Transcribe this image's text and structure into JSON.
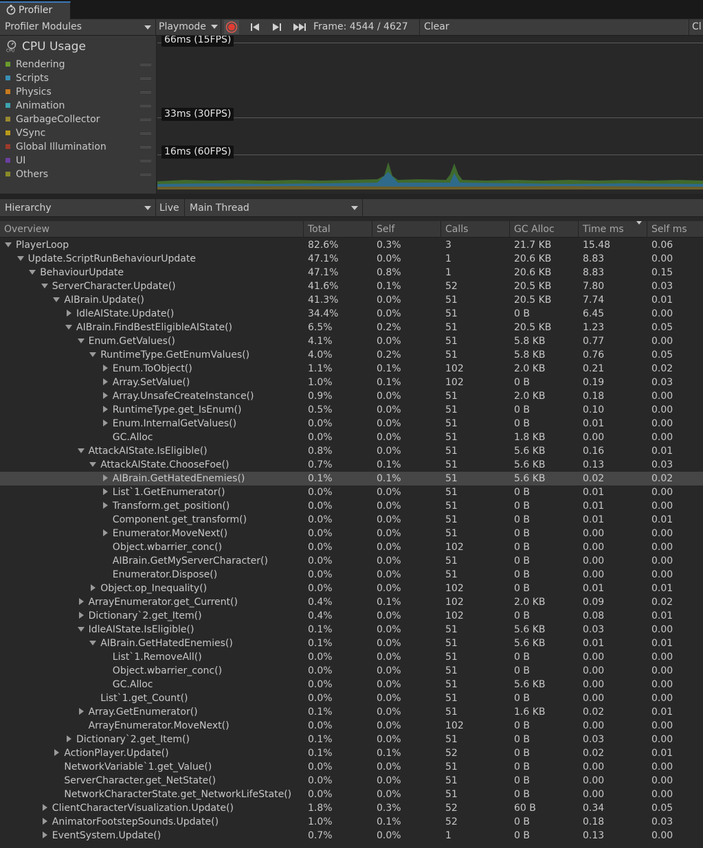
{
  "window": {
    "tab_title": "Profiler"
  },
  "toolbar": {
    "modules_label": "Profiler Modules",
    "playmode_label": "Playmode",
    "frame_text": "Frame: 4544 / 4627",
    "clear_label": "Clear",
    "clear_on_play_partial": "Cl"
  },
  "cpu_module": {
    "title": "CPU Usage",
    "legend": [
      {
        "label": "Rendering",
        "color": "#6a9b2d"
      },
      {
        "label": "Scripts",
        "color": "#3a8fb5"
      },
      {
        "label": "Physics",
        "color": "#c97a1e"
      },
      {
        "label": "Animation",
        "color": "#3ea3b0"
      },
      {
        "label": "GarbageCollector",
        "color": "#9a8a30"
      },
      {
        "label": "VSync",
        "color": "#b89a1a"
      },
      {
        "label": "Global Illumination",
        "color": "#9c3a2c"
      },
      {
        "label": "UI",
        "color": "#6b3fa0"
      },
      {
        "label": "Others",
        "color": "#8a8a2a"
      }
    ],
    "markers": [
      "66ms (15FPS)",
      "33ms (30FPS)",
      "16ms (60FPS)"
    ]
  },
  "hierarchy_toolbar": {
    "view_label": "Hierarchy",
    "live_label": "Live",
    "thread_label": "Main Thread"
  },
  "table": {
    "columns": [
      "Overview",
      "Total",
      "Self",
      "Calls",
      "GC Alloc",
      "Time ms",
      "Self ms"
    ],
    "sorted_column": "Time ms",
    "selected_row": 17,
    "rows": [
      {
        "d": 0,
        "exp": "open",
        "name": "PlayerLoop",
        "total": "82.6%",
        "self": "0.3%",
        "calls": "3",
        "gc": "21.7 KB",
        "time": "15.48",
        "selfms": "0.06"
      },
      {
        "d": 1,
        "exp": "open",
        "name": "Update.ScriptRunBehaviourUpdate",
        "total": "47.1%",
        "self": "0.0%",
        "calls": "1",
        "gc": "20.6 KB",
        "time": "8.83",
        "selfms": "0.00"
      },
      {
        "d": 2,
        "exp": "open",
        "name": "BehaviourUpdate",
        "total": "47.1%",
        "self": "0.8%",
        "calls": "1",
        "gc": "20.6 KB",
        "time": "8.83",
        "selfms": "0.15"
      },
      {
        "d": 3,
        "exp": "open",
        "name": "ServerCharacter.Update()",
        "total": "41.6%",
        "self": "0.1%",
        "calls": "52",
        "gc": "20.5 KB",
        "time": "7.80",
        "selfms": "0.03"
      },
      {
        "d": 4,
        "exp": "open",
        "name": "AIBrain.Update()",
        "total": "41.3%",
        "self": "0.0%",
        "calls": "51",
        "gc": "20.5 KB",
        "time": "7.74",
        "selfms": "0.01"
      },
      {
        "d": 5,
        "exp": "closed",
        "name": "IdleAIState.Update()",
        "total": "34.4%",
        "self": "0.0%",
        "calls": "51",
        "gc": "0 B",
        "time": "6.45",
        "selfms": "0.00"
      },
      {
        "d": 5,
        "exp": "open",
        "name": "AIBrain.FindBestEligibleAIState()",
        "total": "6.5%",
        "self": "0.2%",
        "calls": "51",
        "gc": "20.5 KB",
        "time": "1.23",
        "selfms": "0.05"
      },
      {
        "d": 6,
        "exp": "open",
        "name": "Enum.GetValues()",
        "total": "4.1%",
        "self": "0.0%",
        "calls": "51",
        "gc": "5.8 KB",
        "time": "0.77",
        "selfms": "0.00"
      },
      {
        "d": 7,
        "exp": "open",
        "name": "RuntimeType.GetEnumValues()",
        "total": "4.0%",
        "self": "0.2%",
        "calls": "51",
        "gc": "5.8 KB",
        "time": "0.76",
        "selfms": "0.05"
      },
      {
        "d": 8,
        "exp": "closed",
        "name": "Enum.ToObject()",
        "total": "1.1%",
        "self": "0.1%",
        "calls": "102",
        "gc": "2.0 KB",
        "time": "0.21",
        "selfms": "0.02"
      },
      {
        "d": 8,
        "exp": "closed",
        "name": "Array.SetValue()",
        "total": "1.0%",
        "self": "0.1%",
        "calls": "102",
        "gc": "0 B",
        "time": "0.19",
        "selfms": "0.03"
      },
      {
        "d": 8,
        "exp": "closed",
        "name": "Array.UnsafeCreateInstance()",
        "total": "0.9%",
        "self": "0.0%",
        "calls": "51",
        "gc": "2.0 KB",
        "time": "0.18",
        "selfms": "0.00"
      },
      {
        "d": 8,
        "exp": "closed",
        "name": "RuntimeType.get_IsEnum()",
        "total": "0.5%",
        "self": "0.0%",
        "calls": "51",
        "gc": "0 B",
        "time": "0.10",
        "selfms": "0.00"
      },
      {
        "d": 8,
        "exp": "closed",
        "name": "Enum.InternalGetValues()",
        "total": "0.0%",
        "self": "0.0%",
        "calls": "51",
        "gc": "0 B",
        "time": "0.01",
        "selfms": "0.00"
      },
      {
        "d": 8,
        "exp": "none",
        "name": "GC.Alloc",
        "total": "0.0%",
        "self": "0.0%",
        "calls": "51",
        "gc": "1.8 KB",
        "time": "0.00",
        "selfms": "0.00"
      },
      {
        "d": 6,
        "exp": "open",
        "name": "AttackAIState.IsEligible()",
        "total": "0.8%",
        "self": "0.0%",
        "calls": "51",
        "gc": "5.6 KB",
        "time": "0.16",
        "selfms": "0.01"
      },
      {
        "d": 7,
        "exp": "open",
        "name": "AttackAIState.ChooseFoe()",
        "total": "0.7%",
        "self": "0.1%",
        "calls": "51",
        "gc": "5.6 KB",
        "time": "0.13",
        "selfms": "0.03"
      },
      {
        "d": 8,
        "exp": "closed",
        "name": "AIBrain.GetHatedEnemies()",
        "total": "0.1%",
        "self": "0.1%",
        "calls": "51",
        "gc": "5.6 KB",
        "time": "0.02",
        "selfms": "0.02"
      },
      {
        "d": 8,
        "exp": "closed",
        "name": "List`1.GetEnumerator()",
        "total": "0.0%",
        "self": "0.0%",
        "calls": "51",
        "gc": "0 B",
        "time": "0.01",
        "selfms": "0.00"
      },
      {
        "d": 8,
        "exp": "closed",
        "name": "Transform.get_position()",
        "total": "0.0%",
        "self": "0.0%",
        "calls": "51",
        "gc": "0 B",
        "time": "0.01",
        "selfms": "0.00"
      },
      {
        "d": 8,
        "exp": "none",
        "name": "Component.get_transform()",
        "total": "0.0%",
        "self": "0.0%",
        "calls": "51",
        "gc": "0 B",
        "time": "0.01",
        "selfms": "0.01"
      },
      {
        "d": 8,
        "exp": "closed",
        "name": "Enumerator.MoveNext()",
        "total": "0.0%",
        "self": "0.0%",
        "calls": "51",
        "gc": "0 B",
        "time": "0.00",
        "selfms": "0.00"
      },
      {
        "d": 8,
        "exp": "none",
        "name": "Object.wbarrier_conc()",
        "total": "0.0%",
        "self": "0.0%",
        "calls": "102",
        "gc": "0 B",
        "time": "0.00",
        "selfms": "0.00"
      },
      {
        "d": 8,
        "exp": "none",
        "name": "AIBrain.GetMyServerCharacter()",
        "total": "0.0%",
        "self": "0.0%",
        "calls": "51",
        "gc": "0 B",
        "time": "0.00",
        "selfms": "0.00"
      },
      {
        "d": 8,
        "exp": "none",
        "name": "Enumerator.Dispose()",
        "total": "0.0%",
        "self": "0.0%",
        "calls": "51",
        "gc": "0 B",
        "time": "0.00",
        "selfms": "0.00"
      },
      {
        "d": 7,
        "exp": "closed",
        "name": "Object.op_Inequality()",
        "total": "0.0%",
        "self": "0.0%",
        "calls": "102",
        "gc": "0 B",
        "time": "0.01",
        "selfms": "0.01"
      },
      {
        "d": 6,
        "exp": "closed",
        "name": "ArrayEnumerator.get_Current()",
        "total": "0.4%",
        "self": "0.1%",
        "calls": "102",
        "gc": "2.0 KB",
        "time": "0.09",
        "selfms": "0.02"
      },
      {
        "d": 6,
        "exp": "closed",
        "name": "Dictionary`2.get_Item()",
        "total": "0.4%",
        "self": "0.0%",
        "calls": "102",
        "gc": "0 B",
        "time": "0.08",
        "selfms": "0.01"
      },
      {
        "d": 6,
        "exp": "open",
        "name": "IdleAIState.IsEligible()",
        "total": "0.1%",
        "self": "0.0%",
        "calls": "51",
        "gc": "5.6 KB",
        "time": "0.03",
        "selfms": "0.00"
      },
      {
        "d": 7,
        "exp": "open",
        "name": "AIBrain.GetHatedEnemies()",
        "total": "0.1%",
        "self": "0.0%",
        "calls": "51",
        "gc": "5.6 KB",
        "time": "0.01",
        "selfms": "0.01"
      },
      {
        "d": 8,
        "exp": "none",
        "name": "List`1.RemoveAll()",
        "total": "0.0%",
        "self": "0.0%",
        "calls": "51",
        "gc": "0 B",
        "time": "0.00",
        "selfms": "0.00"
      },
      {
        "d": 8,
        "exp": "none",
        "name": "Object.wbarrier_conc()",
        "total": "0.0%",
        "self": "0.0%",
        "calls": "51",
        "gc": "0 B",
        "time": "0.00",
        "selfms": "0.00"
      },
      {
        "d": 8,
        "exp": "none",
        "name": "GC.Alloc",
        "total": "0.0%",
        "self": "0.0%",
        "calls": "51",
        "gc": "5.6 KB",
        "time": "0.00",
        "selfms": "0.00"
      },
      {
        "d": 7,
        "exp": "none",
        "name": "List`1.get_Count()",
        "total": "0.0%",
        "self": "0.0%",
        "calls": "51",
        "gc": "0 B",
        "time": "0.00",
        "selfms": "0.00"
      },
      {
        "d": 6,
        "exp": "closed",
        "name": "Array.GetEnumerator()",
        "total": "0.1%",
        "self": "0.0%",
        "calls": "51",
        "gc": "1.6 KB",
        "time": "0.02",
        "selfms": "0.01"
      },
      {
        "d": 6,
        "exp": "none",
        "name": "ArrayEnumerator.MoveNext()",
        "total": "0.0%",
        "self": "0.0%",
        "calls": "102",
        "gc": "0 B",
        "time": "0.00",
        "selfms": "0.00"
      },
      {
        "d": 5,
        "exp": "closed",
        "name": "Dictionary`2.get_Item()",
        "total": "0.1%",
        "self": "0.0%",
        "calls": "51",
        "gc": "0 B",
        "time": "0.03",
        "selfms": "0.00"
      },
      {
        "d": 4,
        "exp": "closed",
        "name": "ActionPlayer.Update()",
        "total": "0.1%",
        "self": "0.1%",
        "calls": "52",
        "gc": "0 B",
        "time": "0.02",
        "selfms": "0.01"
      },
      {
        "d": 4,
        "exp": "none",
        "name": "NetworkVariable`1.get_Value()",
        "total": "0.0%",
        "self": "0.0%",
        "calls": "51",
        "gc": "0 B",
        "time": "0.00",
        "selfms": "0.00"
      },
      {
        "d": 4,
        "exp": "none",
        "name": "ServerCharacter.get_NetState()",
        "total": "0.0%",
        "self": "0.0%",
        "calls": "51",
        "gc": "0 B",
        "time": "0.00",
        "selfms": "0.00"
      },
      {
        "d": 4,
        "exp": "none",
        "name": "NetworkCharacterState.get_NetworkLifeState()",
        "total": "0.0%",
        "self": "0.0%",
        "calls": "51",
        "gc": "0 B",
        "time": "0.00",
        "selfms": "0.00"
      },
      {
        "d": 3,
        "exp": "closed",
        "name": "ClientCharacterVisualization.Update()",
        "total": "1.8%",
        "self": "0.3%",
        "calls": "52",
        "gc": "60 B",
        "time": "0.34",
        "selfms": "0.05"
      },
      {
        "d": 3,
        "exp": "closed",
        "name": "AnimatorFootstepSounds.Update()",
        "total": "1.0%",
        "self": "0.1%",
        "calls": "52",
        "gc": "0 B",
        "time": "0.18",
        "selfms": "0.03"
      },
      {
        "d": 3,
        "exp": "closed",
        "name": "EventSystem.Update()",
        "total": "0.7%",
        "self": "0.0%",
        "calls": "1",
        "gc": "0 B",
        "time": "0.13",
        "selfms": "0.00"
      }
    ]
  }
}
